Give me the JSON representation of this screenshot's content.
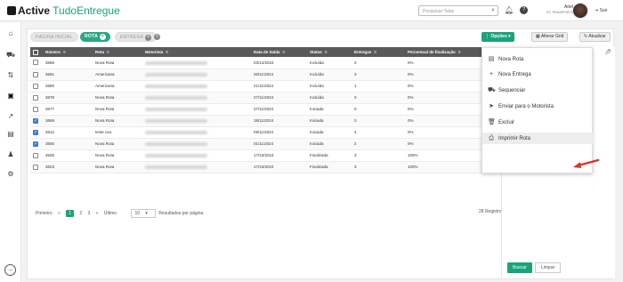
{
  "app": {
    "logo_bold": "Active",
    "logo_light": "TudoEntregue"
  },
  "topbar": {
    "search_placeholder": "Pesquisar Telas",
    "user_name": "Ariel",
    "user_company": "RC TRANSPORTE",
    "logout_label": "Sair"
  },
  "sidebar": {
    "icons": [
      "home-icon",
      "truck-icon",
      "route-icon",
      "map-icon",
      "chart-icon",
      "document-icon",
      "users-icon",
      "gear-icon"
    ]
  },
  "breadcrumbs": [
    {
      "label": "PÁGINA INICIAL",
      "active": false
    },
    {
      "label": "ROTA",
      "active": true
    },
    {
      "label": "ENTREGA",
      "active": false
    }
  ],
  "toolbar": {
    "options_label": "Opções",
    "alter_grid_label": "Alterar Grid",
    "refresh_label": "Atualizar"
  },
  "table": {
    "columns": [
      "Número",
      "Rota",
      "Motorista",
      "Data de Saída",
      "Status",
      "Entregas",
      "Percentual de finalização"
    ],
    "rows": [
      {
        "checked": false,
        "numero": "3686",
        "rota": "Nova Rota",
        "data": "03/12/2024",
        "status": "Incluída",
        "entregas": "0",
        "percentual": "0%"
      },
      {
        "checked": false,
        "numero": "3681",
        "rota": "Americana",
        "data": "26/11/2024",
        "status": "Incluída",
        "entregas": "3",
        "percentual": "0%"
      },
      {
        "checked": false,
        "numero": "3680",
        "rota": "Americana",
        "data": "21/11/2024",
        "status": "Incluída",
        "entregas": "1",
        "percentual": "0%"
      },
      {
        "checked": false,
        "numero": "3678",
        "rota": "Nova Rota",
        "data": "27/11/2024",
        "status": "Incluída",
        "entregas": "0",
        "percentual": "0%"
      },
      {
        "checked": false,
        "numero": "3677",
        "rota": "Nova Rota",
        "data": "27/11/2024",
        "status": "Iniciada",
        "entregas": "0",
        "percentual": "0%"
      },
      {
        "checked": true,
        "numero": "3669",
        "rota": "Nova Rota",
        "data": "18/11/2024",
        "status": "Iniciada",
        "entregas": "0",
        "percentual": "0%"
      },
      {
        "checked": true,
        "numero": "3642",
        "rota": "teste ceo",
        "data": "09/11/2024",
        "status": "Iniciada",
        "entregas": "4",
        "percentual": "0%"
      },
      {
        "checked": true,
        "numero": "3655",
        "rota": "Nova Rota",
        "data": "01/11/2024",
        "status": "Iniciada",
        "entregas": "2",
        "percentual": "0%"
      },
      {
        "checked": false,
        "numero": "3606",
        "rota": "Nova Rota",
        "data": "17/10/2024",
        "status": "Finalizada",
        "entregas": "3",
        "percentual": "100%"
      },
      {
        "checked": false,
        "numero": "3603",
        "rota": "Nova Rota",
        "data": "17/10/2024",
        "status": "Finalizada",
        "entregas": "3",
        "percentual": "100%"
      }
    ]
  },
  "pagination": {
    "first": "Primeiro",
    "prev": "«",
    "pages": [
      "1",
      "2",
      "3"
    ],
    "current": "1",
    "next": "»",
    "last": "Último",
    "per_page": "10",
    "per_page_label": "Resultados por página",
    "total": "28 Registros"
  },
  "options_menu": [
    {
      "icon": "document-icon",
      "label": "Nova Rota"
    },
    {
      "icon": "plus-icon",
      "label": "Nova Entrega"
    },
    {
      "icon": "truck-icon",
      "label": "Sequenciar"
    },
    {
      "icon": "send-icon",
      "label": "Enviar para o Motorista"
    },
    {
      "icon": "trash-icon",
      "label": "Excluir"
    },
    {
      "icon": "printer-icon",
      "label": "Imprimir Rota"
    }
  ],
  "filter_panel": {
    "search_label": "Buscar",
    "clear_label": "Limpar"
  },
  "colors": {
    "accent": "#1aa37a",
    "header": "#5a5a5a",
    "arrow": "#d9342b"
  }
}
